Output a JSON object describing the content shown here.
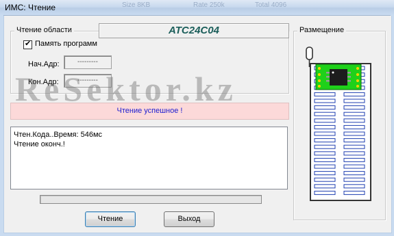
{
  "window": {
    "title": "ИМС: Чтение",
    "ghost_titles": [
      "Size 8KB",
      "Rate 250k",
      "Total 4096"
    ]
  },
  "read_area": {
    "group_title": "Чтение области",
    "chip_name": "ATC24C04",
    "checkbox_label": "Память программ",
    "checkbox_checked": true,
    "checkbox_mark": "✔",
    "start_label": "Нач.Адр:",
    "start_value": "---------",
    "end_label": "Кон.Адр:",
    "end_value": "---------"
  },
  "status": {
    "text": "Чтение успешное !",
    "color": "#1c1cd0"
  },
  "log": {
    "lines": [
      "Чтен.Кода..Время: 546мс",
      "Чтение оконч.!"
    ]
  },
  "progress": {
    "percent": 0
  },
  "buttons": {
    "read_label": "Чтение",
    "exit_label": "Выход"
  },
  "placement": {
    "group_title": "Размещение",
    "socket_rows": 20,
    "chip_rows": 4
  },
  "watermark": {
    "text": "ReSektor.kz"
  },
  "colors": {
    "chip_title": "#1b5e5a",
    "status_bg": "#fcd9d9",
    "pcb_green": "#1fd11a",
    "pin_blue": "#1f3fb0"
  }
}
